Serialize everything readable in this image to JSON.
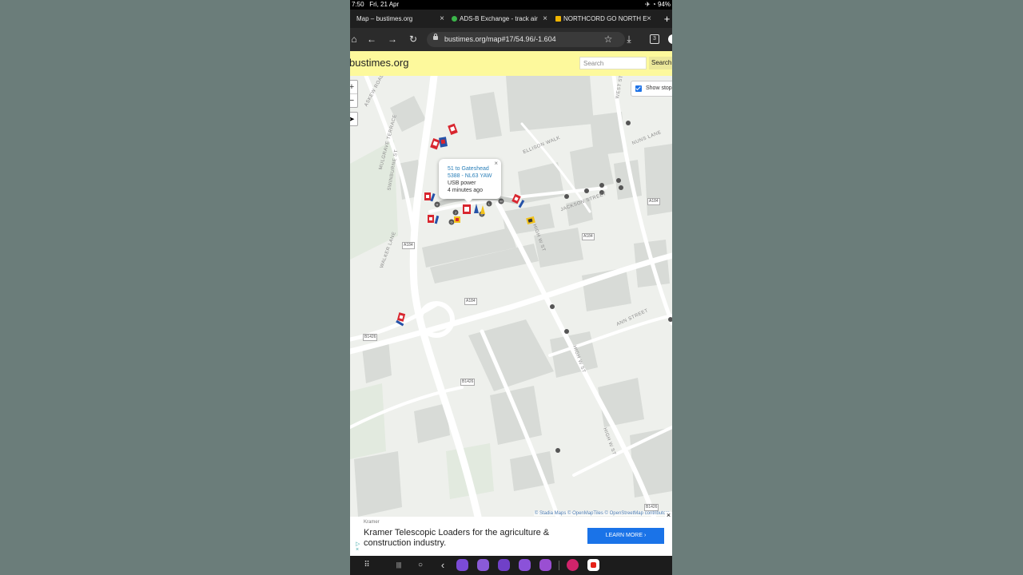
{
  "status_bar": {
    "time": "7:50",
    "date": "Fri, 21 Apr",
    "battery": "94%"
  },
  "tabs": [
    {
      "title": "Map – bustimes.org"
    },
    {
      "title": "ADS-B Exchange - track air"
    },
    {
      "title": "NORTHCORD GO NORTH E"
    }
  ],
  "new_tab_label": "+",
  "toolbar": {
    "url": "bustimes.org/map#17/54.96/-1.604",
    "tab_count": "3"
  },
  "site": {
    "name": "bustimes.org",
    "search_placeholder": "Search",
    "search_button": "Search"
  },
  "map": {
    "zoom_in": "+",
    "zoom_out": "−",
    "show_stops_label": "Show stops",
    "popup": {
      "route": "51 to Gateshead",
      "vehicle": "5388 - NL63 YAW",
      "feature": "USB power",
      "age": "4 minutes ago",
      "close": "×"
    },
    "road_labels": [
      "A184",
      "A184",
      "A184",
      "A184",
      "B1426",
      "B1426",
      "B1426"
    ],
    "street_names": [
      "ASKEW ROAD",
      "MULGRAVE TERRACE",
      "ELLISON WALK",
      "NUNS LANE",
      "JACKSON STREET",
      "WEST STREET",
      "HIGH W ST",
      "ANN STREET",
      "HIGH W ST",
      "HIGH W ST",
      "SWINBURNE ST",
      "WALKER LANE"
    ],
    "attribution": "© Stadia Maps © OpenMapTiles © OpenStreetMap contributors",
    "colors": {
      "bus_red": "#d8262f",
      "bus_blue": "#2552a8",
      "bus_yellow": "#f2c21b",
      "stop_dot": "#555555"
    }
  },
  "ad": {
    "advertiser": "Kramer",
    "text": "Kramer Telescopic Loaders for the agriculture & construction industry.",
    "cta": "LEARN MORE ›",
    "close": "×"
  },
  "nav": {
    "recents": "|||",
    "home": "○",
    "back": "‹",
    "apps_grid": "⠿"
  }
}
